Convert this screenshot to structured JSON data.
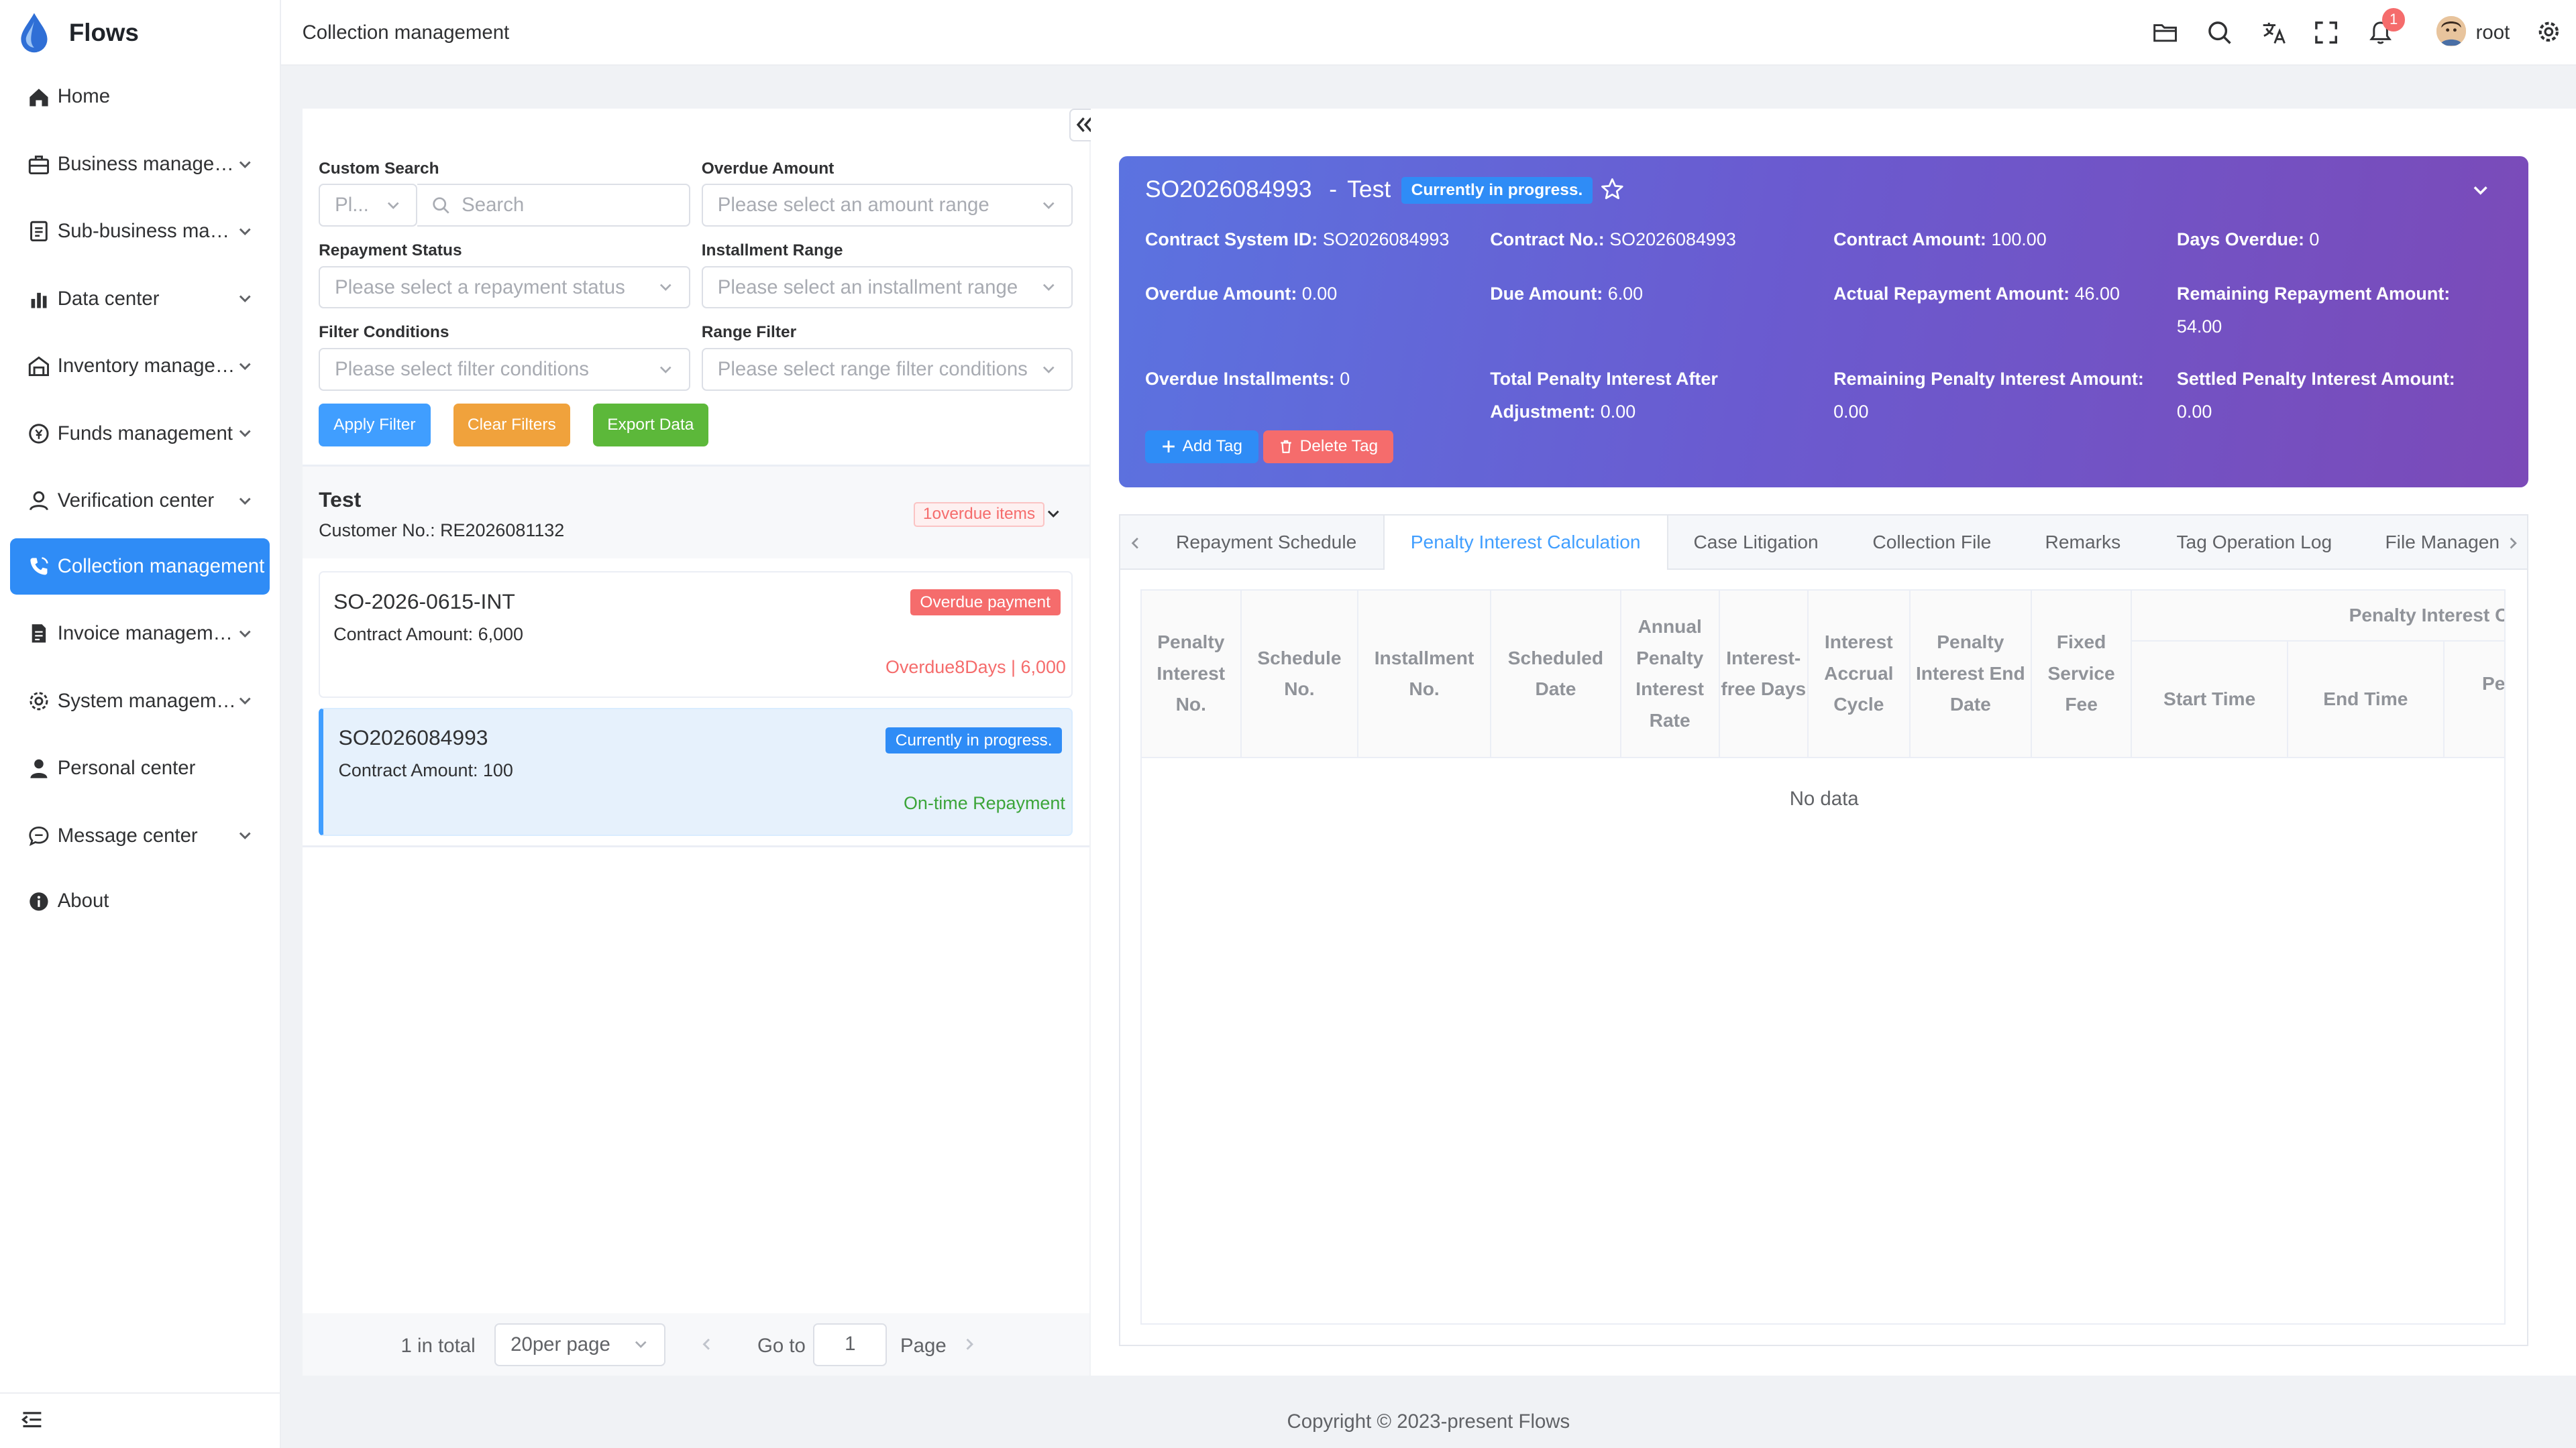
{
  "app": {
    "name": "Flows"
  },
  "sidebar": {
    "items": [
      {
        "label": "Home",
        "icon": "home-icon"
      },
      {
        "label": "Business management",
        "icon": "briefcase-icon"
      },
      {
        "label": "Sub-business management",
        "icon": "document-icon"
      },
      {
        "label": "Data center",
        "icon": "bar-chart-icon"
      },
      {
        "label": "Inventory management",
        "icon": "warehouse-icon"
      },
      {
        "label": "Funds management",
        "icon": "money-icon"
      },
      {
        "label": "Verification center",
        "icon": "user-check-icon"
      },
      {
        "label": "Collection management",
        "icon": "phone-icon",
        "active": true
      },
      {
        "label": "Invoice management",
        "icon": "invoice-icon"
      },
      {
        "label": "System management",
        "icon": "gear-icon"
      },
      {
        "label": "Personal center",
        "icon": "person-icon"
      },
      {
        "label": "Message center",
        "icon": "chat-icon"
      },
      {
        "label": "About",
        "icon": "info-icon"
      }
    ]
  },
  "header": {
    "breadcrumb": "Collection management",
    "notification_count": "1",
    "username": "root"
  },
  "filters": {
    "custom_search": {
      "label": "Custom Search",
      "select_placeholder": "Pl...",
      "input_placeholder": "Search"
    },
    "overdue_amount": {
      "label": "Overdue Amount",
      "placeholder": "Please select an amount range"
    },
    "repayment_status": {
      "label": "Repayment Status",
      "placeholder": "Please select a repayment status"
    },
    "installment_range": {
      "label": "Installment Range",
      "placeholder": "Please select an installment range"
    },
    "filter_conditions": {
      "label": "Filter Conditions",
      "placeholder": "Please select filter conditions"
    },
    "range_filter": {
      "label": "Range Filter",
      "placeholder": "Please select range filter conditions"
    },
    "apply_label": "Apply Filter",
    "clear_label": "Clear Filters",
    "export_label": "Export Data"
  },
  "customer": {
    "name": "Test",
    "number_text": "Customer No.: RE2026081132",
    "overdue_badge": "1overdue items"
  },
  "contracts": [
    {
      "id": "SO-2026-0615-INT",
      "amount_text": "Contract Amount: 6,000",
      "status": "Overdue payment",
      "note": "Overdue8Days | 6,000"
    },
    {
      "id": "SO2026084993",
      "amount_text": "Contract Amount: 100",
      "status": "Currently in progress.",
      "note": "On-time Repayment"
    }
  ],
  "pagination": {
    "total_text": "1 in total",
    "page_size": "20per page",
    "goto_label": "Go to",
    "page_value": "1",
    "page_label": "Page"
  },
  "detail": {
    "contract_id": "SO2026084993",
    "separator": "-",
    "customer_name": "Test",
    "status": "Currently in progress.",
    "fields": {
      "contract_system_id": {
        "label": "Contract System ID:",
        "value": "SO2026084993"
      },
      "contract_no": {
        "label": "Contract No.:",
        "value": "SO2026084993"
      },
      "contract_amount": {
        "label": "Contract Amount:",
        "value": "100.00"
      },
      "days_overdue": {
        "label": "Days Overdue:",
        "value": "0"
      },
      "overdue_amount": {
        "label": "Overdue Amount:",
        "value": "0.00"
      },
      "due_amount": {
        "label": "Due Amount:",
        "value": "6.00"
      },
      "actual_repayment": {
        "label": "Actual Repayment Amount:",
        "value": "46.00"
      },
      "remaining_repayment": {
        "label": "Remaining Repayment Amount:",
        "value": "54.00"
      },
      "overdue_installments": {
        "label": "Overdue Installments:",
        "value": "0"
      },
      "total_penalty_after": {
        "label": "Total Penalty Interest After Adjustment:",
        "value": "0.00"
      },
      "remaining_penalty": {
        "label": "Remaining Penalty Interest Amount:",
        "value": "0.00"
      },
      "settled_penalty": {
        "label": "Settled Penalty Interest Amount:",
        "value": "0.00"
      }
    },
    "add_tag_label": "Add Tag",
    "delete_tag_label": "Delete Tag"
  },
  "tabs": [
    "Repayment Schedule",
    "Penalty Interest Calculation",
    "Case Litigation",
    "Collection File",
    "Remarks",
    "Tag Operation Log",
    "File Managen"
  ],
  "active_tab": "Penalty Interest Calculation",
  "table": {
    "group_header": "Penalty Interest C",
    "columns": [
      "Penalty Interest No.",
      "Schedule No.",
      "Installment No.",
      "Scheduled Date",
      "Annual Penalty Interest Rate",
      "Interest-free Days",
      "Interest Accrual Cycle",
      "Penalty Interest End Date",
      "Fixed Service Fee"
    ],
    "sub_columns": [
      "Start Time",
      "End Time",
      "Per Inte Da"
    ],
    "empty_text": "No data"
  },
  "footer": {
    "copyright": "Copyright © 2023-present Flows"
  },
  "colors": {
    "primary": "#2f8cf6",
    "danger": "#f56c6c",
    "warning": "#f0a23c",
    "success": "#5cb83a",
    "hero_start": "#5b73e0",
    "hero_end": "#7b4ab8"
  }
}
